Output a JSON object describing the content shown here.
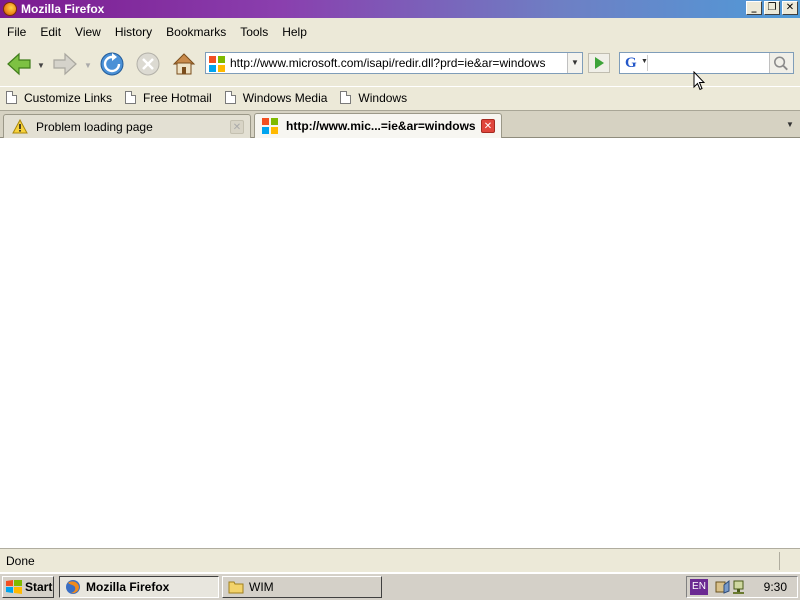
{
  "window": {
    "title": "Mozilla Firefox",
    "controls": {
      "minimize": "_",
      "restore": "❐",
      "close": "✕"
    }
  },
  "menu": [
    "File",
    "Edit",
    "View",
    "History",
    "Bookmarks",
    "Tools",
    "Help"
  ],
  "navbar": {
    "url": "http://www.microsoft.com/isapi/redir.dll?prd=ie&ar=windows",
    "search_engine_letter": "G",
    "search_value": "",
    "icons": [
      "back-icon",
      "forward-icon",
      "reload-icon",
      "stop-icon",
      "home-icon",
      "go-icon",
      "magnifier-icon"
    ]
  },
  "bookmarks": [
    "Customize Links",
    "Free Hotmail",
    "Windows Media",
    "Windows"
  ],
  "tabs": [
    {
      "label": "Problem loading page",
      "active": false,
      "icon": "warning-icon"
    },
    {
      "label": "http://www.mic...=ie&ar=windows",
      "active": true,
      "icon": "microsoft-logo-icon"
    }
  ],
  "status": {
    "text": "Done"
  },
  "taskbar": {
    "start_label": "Start",
    "tasks": [
      {
        "label": "Mozilla Firefox",
        "active": true,
        "icon": "firefox-icon"
      },
      {
        "label": "WIM",
        "active": false,
        "icon": "folder-icon"
      }
    ],
    "language": "EN",
    "clock": "9:30"
  },
  "colors": {
    "title_gradient_start": "#7b1a8f",
    "title_gradient_end": "#4f9bd8",
    "chrome_bg": "#ece9d8",
    "active_tab_close": "#e0463c",
    "language_badge": "#6b2a92"
  }
}
